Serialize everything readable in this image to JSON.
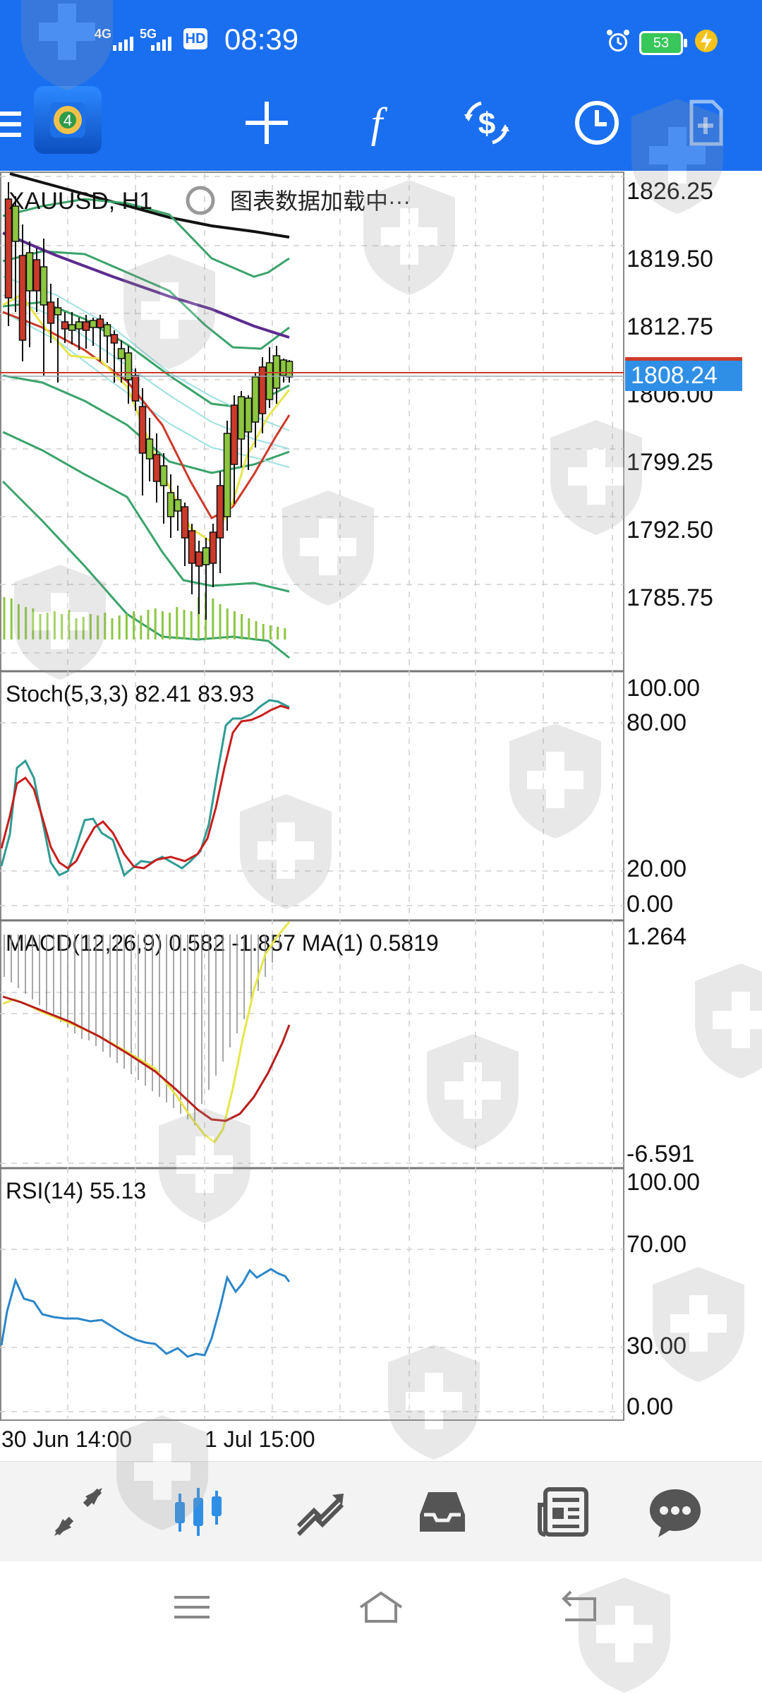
{
  "status_bar": {
    "net1": "4G",
    "net2": "5G",
    "hd": "HD",
    "time": "08:39",
    "battery": "53"
  },
  "toolbar": {
    "icons": [
      "menu-icon",
      "app-logo-icon",
      "crosshair-icon",
      "indicator-f-icon",
      "trade-icon",
      "history-icon",
      "new-order-icon"
    ]
  },
  "main_chart": {
    "symbol_title": "XAUUSD, H1",
    "loading_text": "图表数据加载中···",
    "price_ticks": [
      "1826.25",
      "1819.50",
      "1812.75",
      "1806.00",
      "1799.25",
      "1792.50",
      "1785.75"
    ],
    "current_price": "1808.24",
    "current_price_color": "#2f8fe6"
  },
  "stoch_panel": {
    "title": "Stoch(5,3,3) 82.41 83.93",
    "ticks": [
      "100.00",
      "80.00",
      "20.00",
      "0.00"
    ]
  },
  "macd_panel": {
    "title": "MACD(12,26,9) 0.582 -1.857 MA(1) 0.5819",
    "ticks": [
      "1.264",
      "-6.591"
    ]
  },
  "rsi_panel": {
    "title": "RSI(14) 55.13",
    "ticks": [
      "100.00",
      "70.00",
      "30.00",
      "0.00"
    ]
  },
  "time_axis": [
    "30 Jun 14:00",
    "1 Jul 15:00"
  ],
  "bottom_nav": {
    "items": [
      "quotes-icon",
      "chart-icon",
      "trade-icon",
      "history-icon",
      "news-icon",
      "chat-icon"
    ],
    "active_color": "#2f8fe6"
  },
  "system_nav": [
    "menu-icon",
    "home-icon",
    "back-icon"
  ],
  "colors": {
    "brand": "#1a6ff0",
    "bull": "#8cc63f",
    "bear": "#cc3a2a",
    "bollinger": "#3aa36a",
    "ma_purple": "#5b2d8e",
    "signal_yellow": "#e6e64a"
  }
}
